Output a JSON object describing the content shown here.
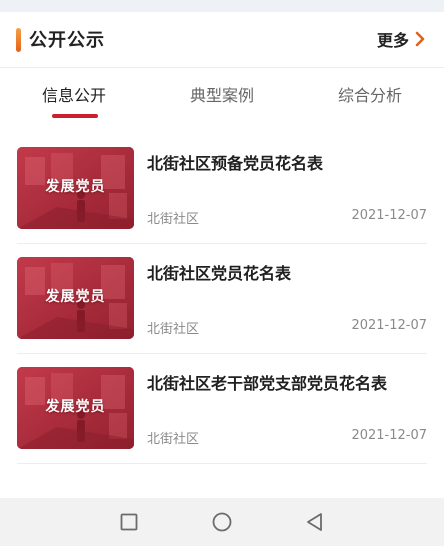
{
  "section": {
    "title": "公开公示",
    "more_label": "更多",
    "accent_gradient": [
      "#f5a043",
      "#e2621c"
    ],
    "more_chevron_color": "#e2621c"
  },
  "tabs": [
    {
      "label": "信息公开",
      "active": true
    },
    {
      "label": "典型案例",
      "active": false
    },
    {
      "label": "综合分析",
      "active": false
    }
  ],
  "tab_indicator_color": "#c8202e",
  "news": [
    {
      "thumbnail_label": "发展党员",
      "title": "北街社区预备党员花名表",
      "source": "北街社区",
      "date": "2021-12-07"
    },
    {
      "thumbnail_label": "发展党员",
      "title": "北街社区党员花名表",
      "source": "北街社区",
      "date": "2021-12-07"
    },
    {
      "thumbnail_label": "发展党员",
      "title": "北街社区老干部党支部党员花名表",
      "source": "北街社区",
      "date": "2021-12-07"
    }
  ],
  "nav_bar": {
    "buttons": [
      "recents-icon",
      "home-icon",
      "back-icon"
    ]
  }
}
